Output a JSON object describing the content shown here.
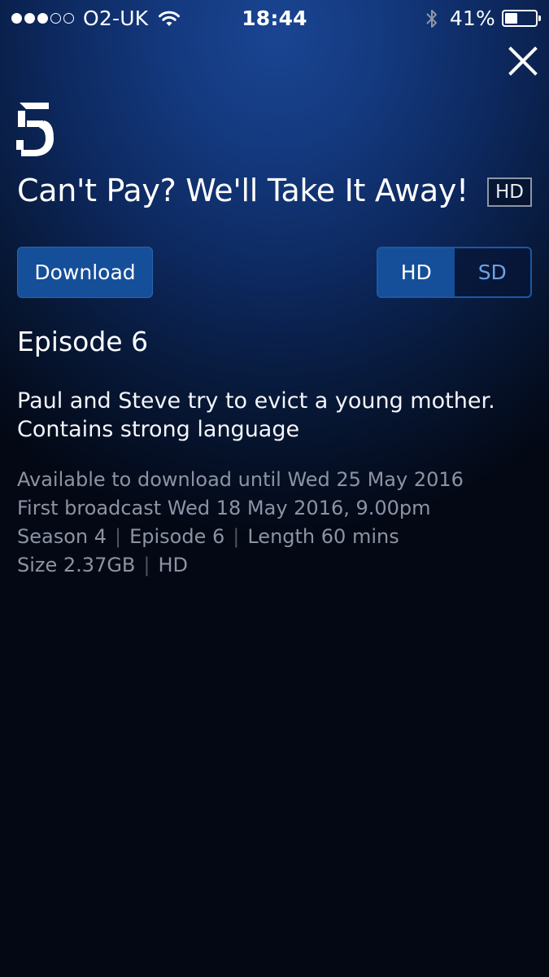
{
  "status_bar": {
    "carrier": "O2-UK",
    "signal_bars_filled": 3,
    "signal_bars_total": 5,
    "time": "18:44",
    "battery_percent_label": "41%",
    "battery_level": 0.41
  },
  "channel": {
    "logo_icon": "channel-5-logo"
  },
  "show": {
    "title": "Can't Pay? We'll Take It Away!",
    "hd_badge": "HD"
  },
  "actions": {
    "download_label": "Download",
    "quality_options": [
      "HD",
      "SD"
    ],
    "quality_selected": "HD"
  },
  "episode": {
    "title": "Episode 6",
    "description": "Paul and Steve try to evict a young mother. Contains strong language",
    "available_until": "Available to download until Wed 25 May 2016",
    "first_broadcast": "First broadcast Wed 18 May 2016, 9.00pm",
    "season": "Season 4",
    "episode_number": "Episode 6",
    "length": "Length 60 mins",
    "size": "Size 2.37GB",
    "format": "HD",
    "separator": "|"
  },
  "colors": {
    "background_top": "#1a4592",
    "background_bottom": "#02050d",
    "button_blue": "#164f99",
    "inactive_option": "#6ea2e2",
    "meta_text": "#8c93a3"
  },
  "icons": [
    "wifi-icon",
    "bluetooth-icon",
    "battery-icon",
    "close-icon"
  ]
}
